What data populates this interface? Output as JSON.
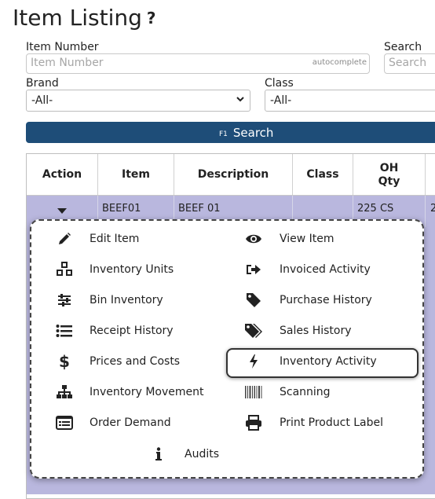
{
  "page": {
    "title": "Item Listing",
    "help_glyph": "?"
  },
  "filters": {
    "item_number": {
      "label": "Item Number",
      "placeholder": "Item Number",
      "hint": "autocomplete"
    },
    "search": {
      "label": "Search",
      "placeholder": "Search"
    },
    "brand": {
      "label": "Brand",
      "value": "-All-"
    },
    "class": {
      "label": "Class",
      "value": "-All-"
    }
  },
  "search_button": {
    "shortcut": "F1",
    "label": "Search"
  },
  "table": {
    "columns": [
      "Action",
      "Item",
      "Description",
      "Class",
      "OH Qty"
    ],
    "row": {
      "item": "BEEF01",
      "description": "BEEF 01",
      "class": "",
      "oh_qty": "225 CS",
      "next_col_partial": "2"
    }
  },
  "action_menu": {
    "left": [
      {
        "label": "Edit Item",
        "icon": "pencil-icon"
      },
      {
        "label": "Inventory Units",
        "icon": "cubes-icon"
      },
      {
        "label": "Bin Inventory",
        "icon": "sliders-icon"
      },
      {
        "label": "Receipt History",
        "icon": "list-icon"
      },
      {
        "label": "Prices and Costs",
        "icon": "dollar-icon"
      },
      {
        "label": "Inventory Movement",
        "icon": "sitemap-icon"
      },
      {
        "label": "Order Demand",
        "icon": "list-alt-icon"
      }
    ],
    "right": [
      {
        "label": "View Item",
        "icon": "eye-icon"
      },
      {
        "label": "Invoiced Activity",
        "icon": "sign-out-icon"
      },
      {
        "label": "Purchase History",
        "icon": "tag-icon"
      },
      {
        "label": "Sales History",
        "icon": "tags-icon"
      },
      {
        "label": "Inventory Activity",
        "icon": "bolt-icon",
        "highlighted": true
      },
      {
        "label": "Scanning",
        "icon": "barcode-icon"
      },
      {
        "label": "Print Product Label",
        "icon": "print-icon"
      }
    ],
    "bottom": {
      "label": "Audits",
      "icon": "info-icon"
    }
  }
}
